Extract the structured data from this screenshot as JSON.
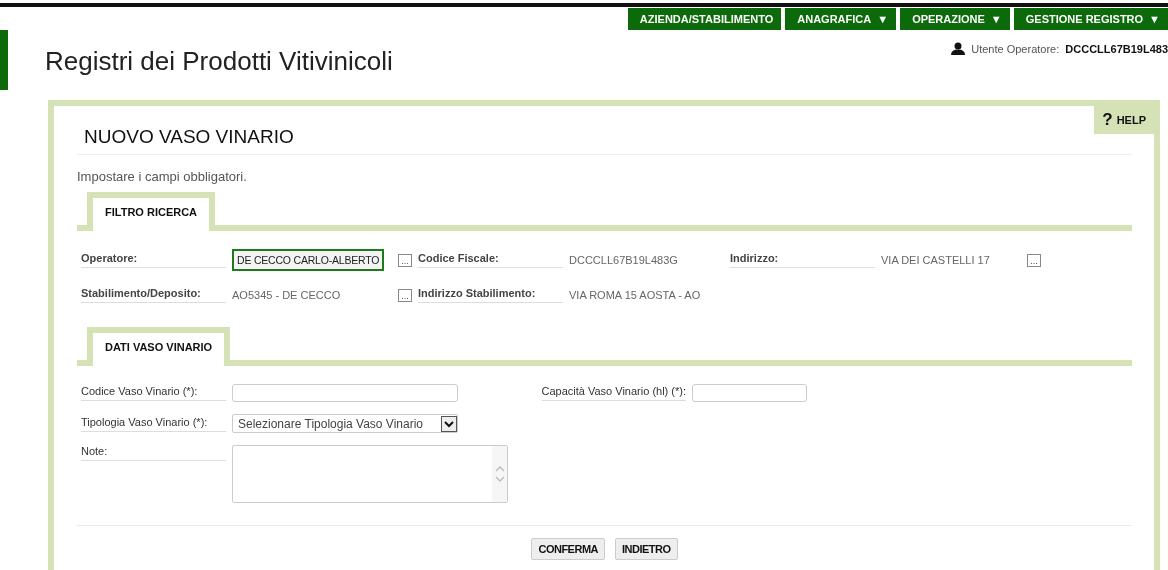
{
  "nav": [
    {
      "label": "AZIENDA/STABILIMENTO"
    },
    {
      "label": "ANAGRAFICA",
      "caret": "▼"
    },
    {
      "label": "OPERAZIONE",
      "caret": "▼"
    },
    {
      "label": "GESTIONE REGISTRO",
      "caret": "▼"
    }
  ],
  "app_title": "Registri dei Prodotti Vitivinicoli",
  "user": {
    "label": "Utente Operatore:",
    "value": "DCCCLL67B19L483"
  },
  "page": {
    "title": "NUOVO VASO VINARIO",
    "help": "HELP",
    "help_mark": "?",
    "instructions": "Impostare i campi obbligatori."
  },
  "filter_section": {
    "tab": "FILTRO RICERCA",
    "fields": [
      {
        "label": "Operatore:",
        "value": "DE CECCO CARLO-ALBERTO",
        "kind": "selected",
        "lookup": "..."
      },
      {
        "label": "Codice Fiscale:",
        "value": "DCCCLL67B19L483G",
        "kind": "text"
      },
      {
        "label": "Indirizzo:",
        "value": "VIA DEI CASTELLI 17",
        "kind": "text",
        "lookup": "..."
      },
      {
        "label": "Stabilimento/Deposito:",
        "value": "AO5345 - DE CECCO",
        "kind": "text",
        "lookup": "..."
      },
      {
        "label": "Indirizzo Stabilimento:",
        "value": "VIA ROMA 15 AOSTA -  AO",
        "kind": "text"
      }
    ]
  },
  "data_section": {
    "tab": "DATI VASO VINARIO",
    "codice": {
      "label": "Codice Vaso Vinario (*):"
    },
    "capacita": {
      "label": "Capacità Vaso Vinario (hl) (*):"
    },
    "tipologia": {
      "label": "Tipologia Vaso Vinario (*):",
      "value": "Selezionare Tipologia Vaso Vinario"
    },
    "note": {
      "label": "Note:"
    }
  },
  "buttons": [
    "CONFERMA",
    "INDIETRO"
  ]
}
